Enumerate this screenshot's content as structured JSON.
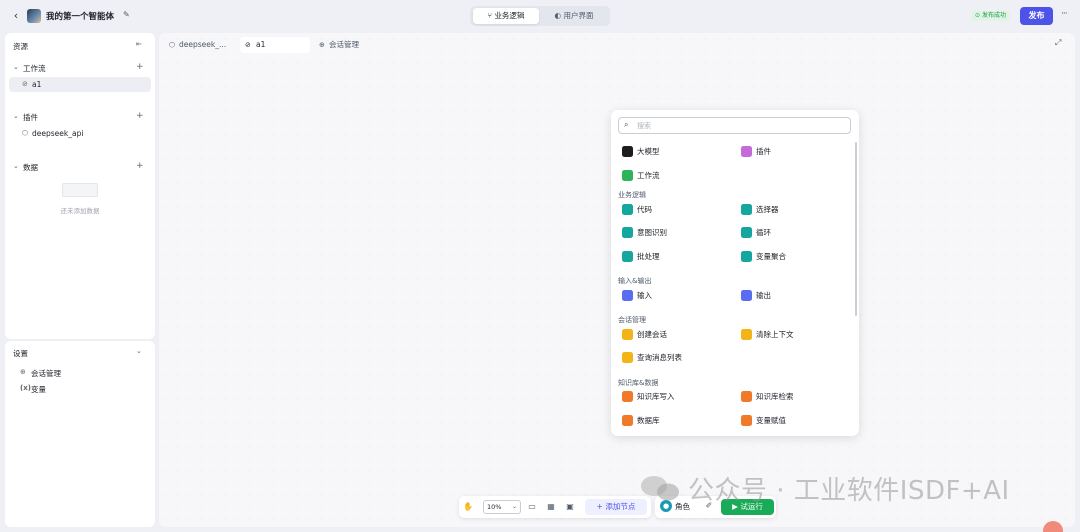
{
  "header": {
    "back_icon": "chevron-left-icon",
    "app_title": "我的第一个智能体",
    "tabs": [
      {
        "label": "业务逻辑",
        "active": true
      },
      {
        "label": "用户界面",
        "active": false
      }
    ],
    "publish_status": "发布成功",
    "publish_label": "发布",
    "more_icon": "more-icon",
    "accent_color": "#4d53e8"
  },
  "sidebar": {
    "title": "资源",
    "sections": [
      {
        "label": "工作流",
        "items": [
          "a1"
        ]
      },
      {
        "label": "插件",
        "items": [
          "deepseek_api"
        ]
      },
      {
        "label": "数据",
        "items": [],
        "empty_text": "还未添加数据"
      }
    ]
  },
  "settings": {
    "title": "设置",
    "items": [
      {
        "icon": "chat-manage-icon",
        "label": "会话管理"
      },
      {
        "icon": "variable-icon",
        "glyph": "(x)",
        "label": "变量"
      }
    ]
  },
  "canvas": {
    "tabs": [
      {
        "label": "deepseek_...",
        "active": false
      },
      {
        "label": "a1",
        "active": true
      },
      {
        "label": "会话管理",
        "active": false
      }
    ]
  },
  "node_panel": {
    "search_placeholder": "搜索",
    "top": [
      {
        "label": "大模型",
        "color": "#1d1d1f",
        "icon": "llm-icon"
      },
      {
        "label": "插件",
        "color": "#c26bd9",
        "icon": "plugin-icon"
      },
      {
        "label": "工作流",
        "color": "#2bb45a",
        "icon": "workflow-icon"
      }
    ],
    "sections": [
      {
        "title": "业务逻辑",
        "items": [
          {
            "label": "代码",
            "color": "#16a6a0",
            "icon": "code-icon"
          },
          {
            "label": "选择器",
            "color": "#16a6a0",
            "icon": "if-icon"
          },
          {
            "label": "意图识别",
            "color": "#16a6a0",
            "icon": "intent-icon"
          },
          {
            "label": "循环",
            "color": "#16a6a0",
            "icon": "loop-icon"
          },
          {
            "label": "批处理",
            "color": "#16a6a0",
            "icon": "batch-icon"
          },
          {
            "label": "变量聚合",
            "color": "#16a6a0",
            "icon": "aggregate-icon"
          }
        ]
      },
      {
        "title": "输入&输出",
        "items": [
          {
            "label": "输入",
            "color": "#5a6cf0",
            "icon": "input-icon"
          },
          {
            "label": "输出",
            "color": "#5a6cf0",
            "icon": "output-icon"
          }
        ]
      },
      {
        "title": "会话管理",
        "items": [
          {
            "label": "创建会话",
            "color": "#f2b417",
            "icon": "create-chat-icon"
          },
          {
            "label": "清除上下文",
            "color": "#f2b417",
            "icon": "clear-context-icon"
          },
          {
            "label": "查询消息列表",
            "color": "#f2b417",
            "icon": "message-list-icon"
          }
        ]
      },
      {
        "title": "知识库&数据",
        "items": [
          {
            "label": "知识库写入",
            "color": "#f07a2a",
            "icon": "kb-write-icon"
          },
          {
            "label": "知识库检索",
            "color": "#f07a2a",
            "icon": "kb-search-icon"
          },
          {
            "label": "数据库",
            "color": "#f07a2a",
            "icon": "database-icon"
          },
          {
            "label": "变量赋值",
            "color": "#f07a2a",
            "icon": "assign-icon"
          }
        ]
      }
    ]
  },
  "toolbar": {
    "zoom": "10%",
    "add_node_label": "添加节点",
    "role_label": "角色",
    "run_label": "试运行",
    "run_color": "#1aab58"
  },
  "watermark": "公众号 · 工业软件ISDF+AI"
}
